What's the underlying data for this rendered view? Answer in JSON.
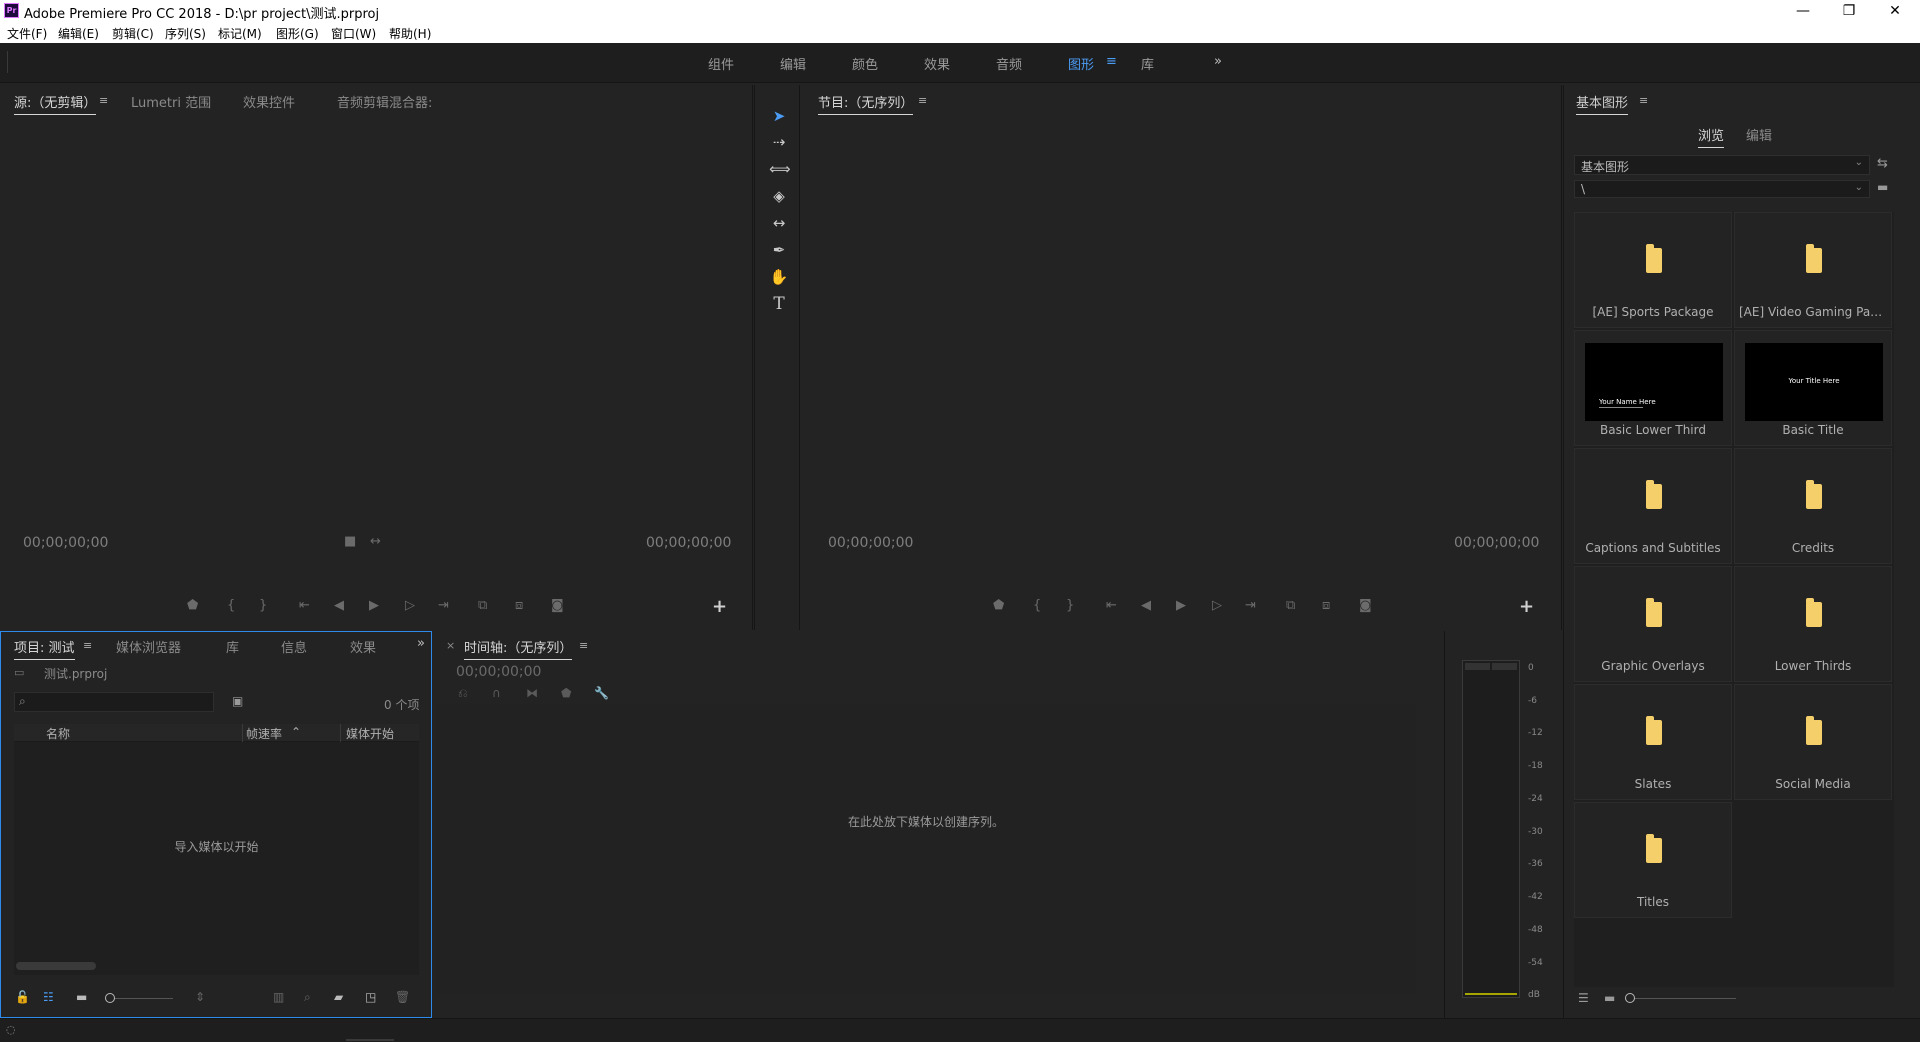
{
  "window": {
    "logo_text": "Pr",
    "title": "Adobe Premiere Pro CC 2018 - D:\\pr project\\测试.prproj",
    "minimize": "—",
    "restore": "❐",
    "close": "✕"
  },
  "menu": [
    "文件(F)",
    "编辑(E)",
    "剪辑(C)",
    "序列(S)",
    "标记(M)",
    "图形(G)",
    "窗口(W)",
    "帮助(H)"
  ],
  "workspaces": {
    "items": [
      "组件",
      "编辑",
      "颜色",
      "效果",
      "音频",
      "图形",
      "库"
    ],
    "active": "图形",
    "more": "»"
  },
  "source_panel": {
    "tabs": [
      "源:（无剪辑）",
      "Lumetri 范围",
      "效果控件",
      "音频剪辑混合器:"
    ],
    "timecode_left": "00;00;00;00",
    "timecode_right": "00;00;00;00"
  },
  "program_panel": {
    "tab": "节目:（无序列）",
    "timecode_left": "00;00;00;00",
    "timecode_right": "00;00;00;00"
  },
  "tools": [
    "selection-tool",
    "track-select-tool",
    "ripple-edit-tool",
    "razor-tool",
    "slip-tool",
    "pen-tool",
    "hand-tool",
    "type-tool"
  ],
  "project_panel": {
    "tabs": [
      "项目: 测试",
      "媒体浏览器",
      "库",
      "信息",
      "效果"
    ],
    "more": "»",
    "file_name": "测试.prproj",
    "item_count": "0 个项",
    "columns": [
      "名称",
      "帧速率",
      "媒体开始"
    ],
    "empty_message": "导入媒体以开始"
  },
  "timeline_panel": {
    "tab": "时间轴:（无序列）",
    "close": "×",
    "timecode": "00;00;00;00",
    "empty_message": "在此处放下媒体以创建序列。"
  },
  "audio_meter": {
    "scale": [
      "0",
      "-6",
      "-12",
      "-18",
      "-24",
      "-30",
      "-36",
      "-42",
      "-48",
      "-54",
      "dB"
    ]
  },
  "graphics_panel": {
    "title": "基本图形",
    "tabs": [
      "浏览",
      "编辑"
    ],
    "active_tab": "浏览",
    "dropdown1": "基本图形",
    "dropdown2": "\\",
    "items": [
      {
        "label": "[AE] Sports Package",
        "kind": "folder"
      },
      {
        "label": "[AE] Video Gaming Packa...",
        "kind": "folder"
      },
      {
        "label": "Basic Lower Third",
        "kind": "thumbnail",
        "thumb_text": "Your Name Here"
      },
      {
        "label": "Basic Title",
        "kind": "thumbnail",
        "thumb_text": "Your Title Here"
      },
      {
        "label": "Captions and Subtitles",
        "kind": "folder"
      },
      {
        "label": "Credits",
        "kind": "folder"
      },
      {
        "label": "Graphic Overlays",
        "kind": "folder"
      },
      {
        "label": "Lower Thirds",
        "kind": "folder"
      },
      {
        "label": "Slates",
        "kind": "folder"
      },
      {
        "label": "Social Media",
        "kind": "folder"
      },
      {
        "label": "Titles",
        "kind": "folder"
      }
    ]
  },
  "colors": {
    "accent": "#4b9cf5",
    "folder": "#f5cf6a",
    "panel_bg": "#232323",
    "focus_border": "#2d8ceb"
  }
}
